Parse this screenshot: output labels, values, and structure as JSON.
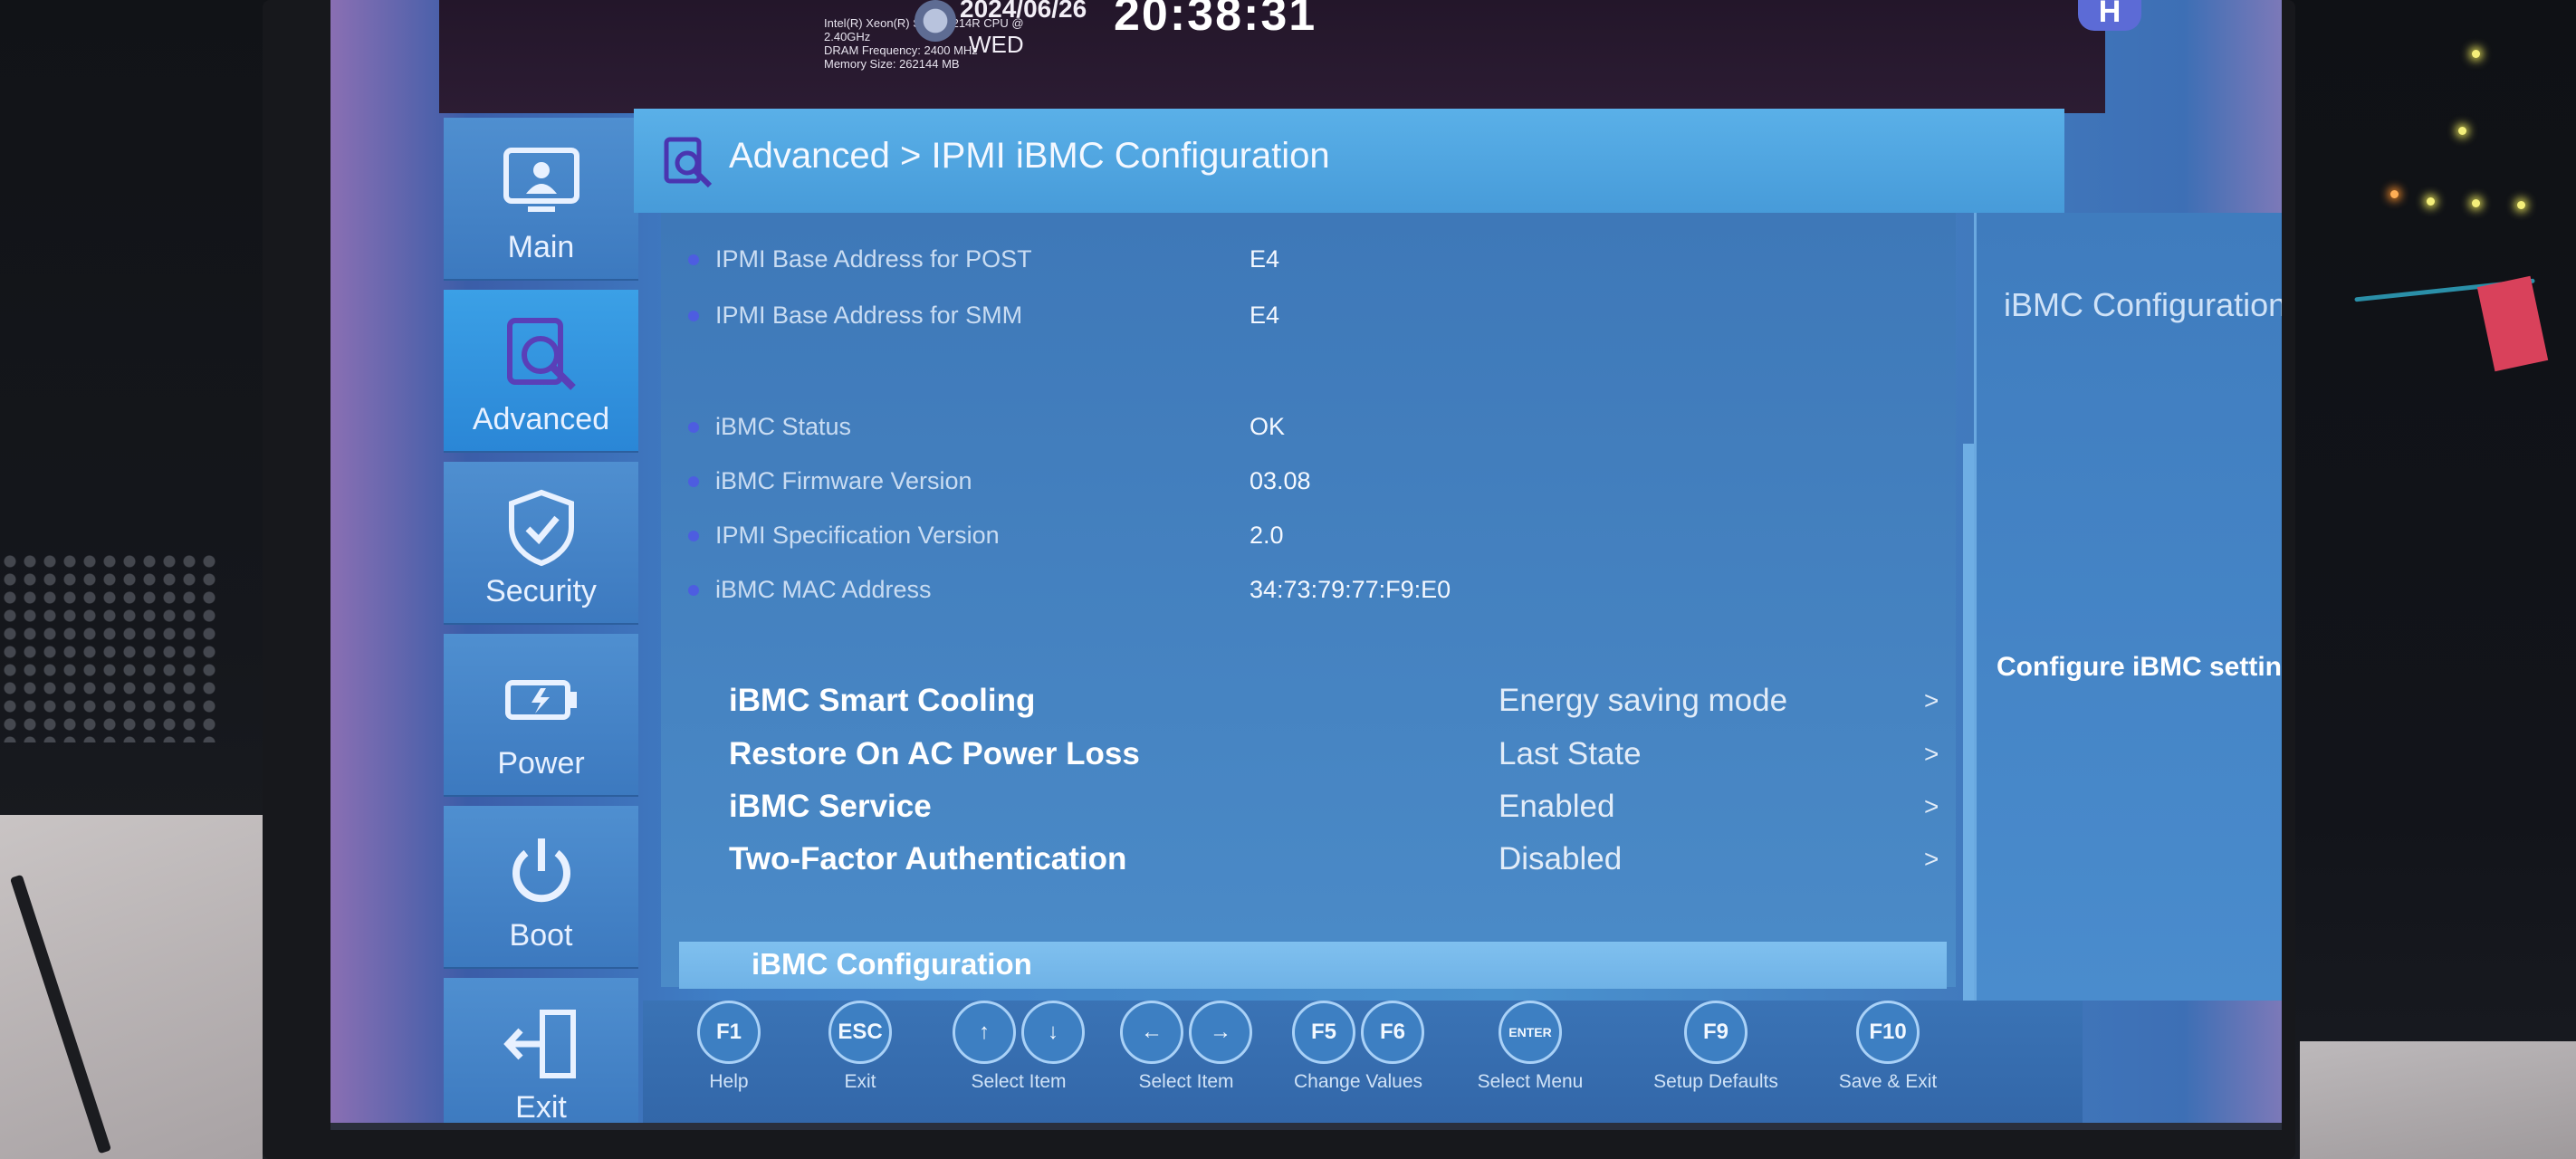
{
  "system_info": {
    "brand": "",
    "cpu_lines": "Intel(R) Xeon(R) Silver 4214R CPU @\n2.40GHz\nDRAM Frequency: 2400 MHz\nMemory Size: 262144 MB",
    "date": "2024/06/26",
    "weekday": "WED",
    "time": "20:38:31",
    "logo_letter": "H"
  },
  "nav": {
    "items": [
      {
        "label": "Main",
        "icon": "monitor-icon"
      },
      {
        "label": "Advanced",
        "icon": "search-document-icon"
      },
      {
        "label": "Security",
        "icon": "shield-check-icon"
      },
      {
        "label": "Power",
        "icon": "battery-icon"
      },
      {
        "label": "Boot",
        "icon": "power-icon"
      },
      {
        "label": "Exit",
        "icon": "exit-door-icon"
      }
    ],
    "active": "Advanced"
  },
  "header": {
    "breadcrumb": "Advanced > IPMI iBMC Configuration"
  },
  "settings": {
    "info_rows": [
      {
        "label": "IPMI Base Address for POST",
        "value": "E4"
      },
      {
        "label": "IPMI Base Address for SMM",
        "value": "E4"
      },
      {
        "label": "iBMC Status",
        "value": "OK"
      },
      {
        "label": "iBMC Firmware Version",
        "value": "03.08"
      },
      {
        "label": "IPMI Specification Version",
        "value": "2.0"
      },
      {
        "label": "iBMC MAC Address",
        "value": "34:73:79:77:F9:E0"
      }
    ],
    "menu_rows": [
      {
        "label": "iBMC Smart Cooling",
        "value": "Energy saving mode",
        "arrow": ">"
      },
      {
        "label": "Restore On AC Power Loss",
        "value": "Last State",
        "arrow": ">"
      },
      {
        "label": "iBMC Service",
        "value": "Enabled",
        "arrow": ">"
      },
      {
        "label": "Two-Factor Authentication",
        "value": "Disabled",
        "arrow": ">"
      }
    ],
    "selected": "iBMC Configuration"
  },
  "help_panel": {
    "title": "iBMC Configuration",
    "description": "Configure iBMC settings."
  },
  "footer": {
    "keys": [
      {
        "buttons": [
          "F1"
        ],
        "label": "Help"
      },
      {
        "buttons": [
          "ESC"
        ],
        "label": "Exit"
      },
      {
        "buttons": [
          "↑",
          "↓"
        ],
        "label": "Select Item"
      },
      {
        "buttons": [
          "←",
          "→"
        ],
        "label": "Select Item"
      },
      {
        "buttons": [
          "F5",
          "F6"
        ],
        "label": "Change Values"
      },
      {
        "buttons": [
          "ENTER"
        ],
        "label": "Select Menu"
      },
      {
        "buttons": [
          "F9"
        ],
        "label": "Setup Defaults"
      },
      {
        "buttons": [
          "F10"
        ],
        "label": "Save & Exit"
      }
    ]
  }
}
